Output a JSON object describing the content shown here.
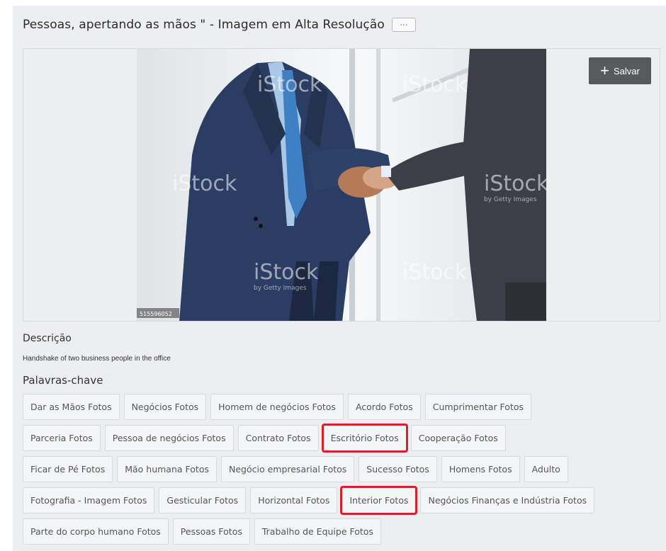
{
  "page": {
    "title": "Pessoas, apertando as mãos \" - Imagem em Alta Resolução",
    "more_label": "···"
  },
  "image": {
    "save_label": "Salvar",
    "save_icon": "plus-icon",
    "watermark_brand": "iStock",
    "watermark_sub": "by Getty Images",
    "stock_id": "515596052"
  },
  "description": {
    "heading": "Descrição",
    "text": "Handshake of two business people in the office"
  },
  "keywords": {
    "heading": "Palavras-chave",
    "highlight_color": "#d2222a",
    "rows": [
      [
        {
          "label": "Dar as Mãos Fotos"
        },
        {
          "label": "Negócios Fotos"
        },
        {
          "label": "Homem de negócios Fotos"
        },
        {
          "label": "Acordo Fotos"
        },
        {
          "label": "Cumprimentar Fotos"
        }
      ],
      [
        {
          "label": "Parceria Fotos"
        },
        {
          "label": "Pessoa de negócios Fotos"
        },
        {
          "label": "Contrato Fotos"
        },
        {
          "label": "Escritório Fotos",
          "highlighted": true
        },
        {
          "label": "Cooperação Fotos"
        }
      ],
      [
        {
          "label": "Ficar de Pé Fotos"
        },
        {
          "label": "Mão humana Fotos"
        },
        {
          "label": "Negócio empresarial Fotos"
        },
        {
          "label": "Sucesso Fotos"
        },
        {
          "label": "Homens Fotos"
        },
        {
          "label": "Adulto"
        }
      ],
      [
        {
          "label": "Fotografia - Imagem Fotos"
        },
        {
          "label": "Gesticular Fotos"
        },
        {
          "label": "Horizontal Fotos"
        },
        {
          "label": "Interior Fotos",
          "highlighted": true
        },
        {
          "label": "Negócios Finanças e Indústria Fotos"
        }
      ],
      [
        {
          "label": "Parte do corpo humano Fotos"
        },
        {
          "label": "Pessoas Fotos"
        },
        {
          "label": "Trabalho de Equipe Fotos"
        }
      ]
    ]
  }
}
